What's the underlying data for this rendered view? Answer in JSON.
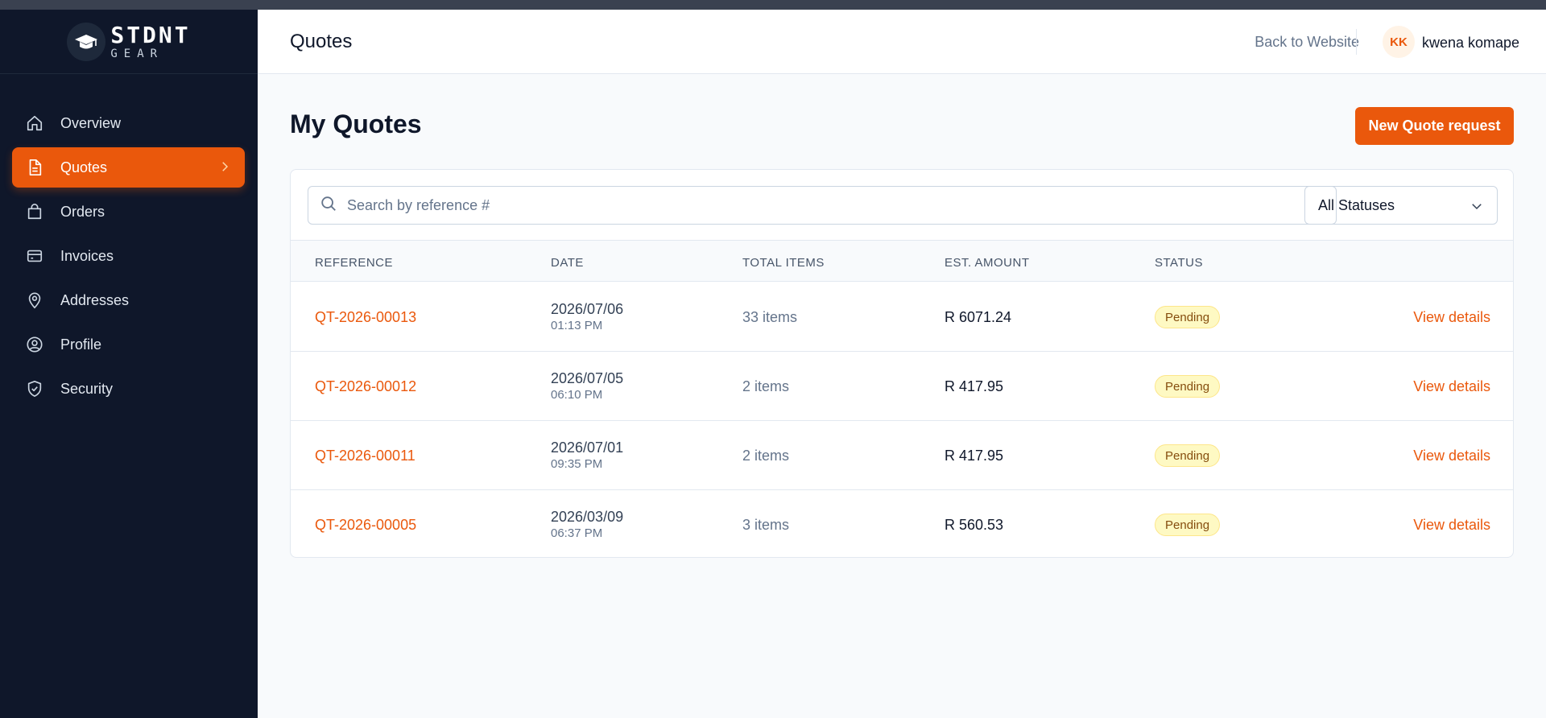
{
  "brand": {
    "name": "STDNT",
    "sub": "GEAR"
  },
  "sidebar": {
    "items": [
      {
        "label": "Overview",
        "icon": "home-icon"
      },
      {
        "label": "Quotes",
        "icon": "document-icon",
        "active": true
      },
      {
        "label": "Orders",
        "icon": "shopping-bag-icon"
      },
      {
        "label": "Invoices",
        "icon": "credit-card-icon"
      },
      {
        "label": "Addresses",
        "icon": "map-pin-icon"
      },
      {
        "label": "Profile",
        "icon": "user-circle-icon"
      },
      {
        "label": "Security",
        "icon": "shield-check-icon"
      }
    ]
  },
  "header": {
    "title": "Quotes",
    "back_link": "Back to Website",
    "user": {
      "initials": "KK",
      "name": "kwena komape"
    }
  },
  "main": {
    "title": "My Quotes",
    "new_quote_label": "New Quote request",
    "search_placeholder": "Search by reference #",
    "status_filter": "All Statuses",
    "columns": [
      "REFERENCE",
      "DATE",
      "TOTAL ITEMS",
      "EST. AMOUNT",
      "STATUS"
    ],
    "view_label": "View details",
    "rows": [
      {
        "reference": "QT-2026-00013",
        "date": "2026/07/06",
        "time": "01:13 PM",
        "items": "33 items",
        "amount": "R 6071.24",
        "status": "Pending"
      },
      {
        "reference": "QT-2026-00012",
        "date": "2026/07/05",
        "time": "06:10 PM",
        "items": "2 items",
        "amount": "R 417.95",
        "status": "Pending"
      },
      {
        "reference": "QT-2026-00011",
        "date": "2026/07/01",
        "time": "09:35 PM",
        "items": "2 items",
        "amount": "R 417.95",
        "status": "Pending"
      },
      {
        "reference": "QT-2026-00005",
        "date": "2026/03/09",
        "time": "06:37 PM",
        "items": "3 items",
        "amount": "R 560.53",
        "status": "Pending"
      }
    ]
  },
  "colors": {
    "accent": "#ea580c",
    "sidebar_bg": "#0f172a",
    "pending_bg": "#fef9c3",
    "pending_text": "#854d0e"
  }
}
